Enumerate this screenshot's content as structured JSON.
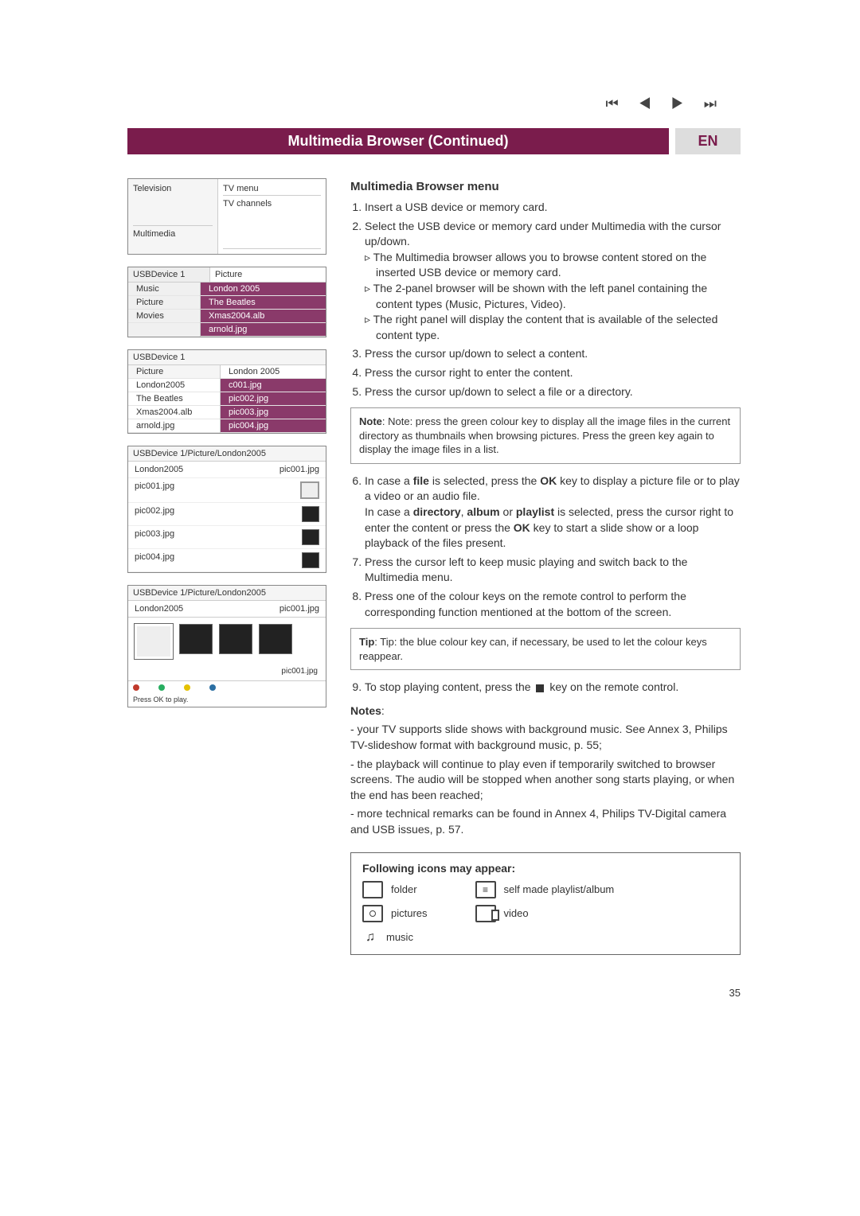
{
  "nav_glyphs": "⏮  ◀  ▶  ⏭",
  "header": {
    "title": "Multimedia Browser   (Continued)",
    "lang": "EN"
  },
  "panel1": {
    "left1": "Television",
    "right1": "TV menu",
    "right2": "TV channels",
    "left2": "Multimedia"
  },
  "panel2": {
    "head_left": "USBDevice 1",
    "head_right": "Picture",
    "left_items": [
      "Music",
      "Picture",
      "Movies"
    ],
    "right_items": [
      "London 2005",
      "The Beatles",
      "Xmas2004.alb",
      "arnold.jpg"
    ]
  },
  "panel3": {
    "head": "USBDevice 1",
    "left_head": "Picture",
    "right_head": "London 2005",
    "left_items": [
      "London2005",
      "The Beatles",
      "Xmas2004.alb",
      "arnold.jpg"
    ],
    "right_items": [
      "c001.jpg",
      "pic002.jpg",
      "pic003.jpg",
      "pic004.jpg"
    ]
  },
  "panel4": {
    "head": "USBDevice 1/Picture/London2005",
    "title_left": "London2005",
    "title_right": "pic001.jpg",
    "files": [
      "pic001.jpg",
      "pic002.jpg",
      "pic003.jpg",
      "pic004.jpg"
    ]
  },
  "panel5": {
    "head": "USBDevice 1/Picture/London2005",
    "title_left": "London2005",
    "title_right": "pic001.jpg",
    "caption": "pic001.jpg",
    "footer": "Press OK to play."
  },
  "body": {
    "h": "Multimedia Browser menu",
    "s1": "Insert a USB device or memory card.",
    "s2": "Select the USB device or memory card under Multimedia with the cursor up/down.",
    "s2a": "The Multimedia browser allows you to browse content stored on the inserted USB device or memory card.",
    "s2b": "The 2-panel browser will be shown with the left panel containing the content types (Music, Pictures, Video).",
    "s2c": "The right panel will display the content that is available of the selected content type.",
    "s3": "Press the cursor up/down to select a content.",
    "s4": "Press the cursor right to enter the content.",
    "s5": "Press the cursor up/down to select a file or a directory.",
    "note1": "Note: press the green colour key to display all the image files in the current directory as thumbnails when browsing pictures. Press the green key again to display the image files in a list.",
    "s6a": "In case a ",
    "s6b": "file",
    "s6c": " is selected, press the ",
    "s6d": "OK",
    "s6e": " key to display a picture file or to play a video or an audio file.",
    "s6f": "In case a ",
    "s6g": "directory",
    "s6h": ", ",
    "s6i": "album",
    "s6j": " or ",
    "s6k": "playlist",
    "s6l": " is selected, press the cursor right to enter the content or press the ",
    "s6m": "OK",
    "s6n": " key to start a slide show or a loop playback of the files present.",
    "s7": "Press the cursor left to keep music playing and switch back to the Multimedia menu.",
    "s8": "Press one of the colour keys on the remote control to perform the corresponding function mentioned at the bottom of the screen.",
    "tip": "Tip: the blue colour key can, if necessary, be used to let the colour keys reappear.",
    "s9a": "To stop playing content, press the ",
    "s9b": " key on the remote control.",
    "notes_head": "Notes",
    "n1": "- your TV supports slide shows with background music. See Annex 3, Philips TV-slideshow format with background music, p. 55;",
    "n2": "- the playback will continue to play even if temporarily switched to browser screens. The audio will be stopped when another song starts playing, or when the end has been reached;",
    "n3": "- more technical remarks can be found in Annex 4, Philips TV-Digital camera and USB issues, p. 57."
  },
  "icons": {
    "head": "Following icons may appear:",
    "folder": "folder",
    "pictures": "pictures",
    "music": "music",
    "playlist": "self made playlist/album",
    "video": "video"
  },
  "page_number": "35"
}
